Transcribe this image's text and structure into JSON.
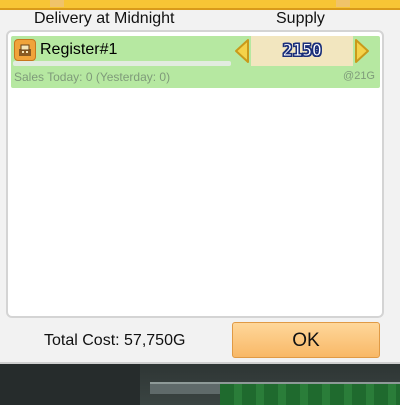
{
  "header": {
    "delivery_label": "Delivery at Midnight",
    "supply_label": "Supply"
  },
  "items": [
    {
      "icon": "cash-register-icon",
      "name": "Register#1",
      "quantity": "2150",
      "sales_text": "Sales Today: 0 (Yesterday: 0)",
      "unit_price": "@21G",
      "progress": 0
    }
  ],
  "footer": {
    "total_cost": "Total Cost: 57,750G",
    "ok_label": "OK"
  },
  "colors": {
    "row_bg": "#b6e8a1",
    "ok_button": "#f8b867",
    "top_bar": "#f7c535",
    "arrow": "#f5d24a"
  }
}
